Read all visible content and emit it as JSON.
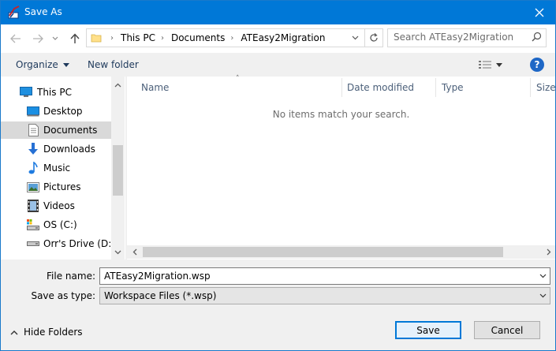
{
  "window": {
    "title": "Save As"
  },
  "address": {
    "breadcrumbs": [
      "This PC",
      "Documents",
      "ATEasy2Migration"
    ]
  },
  "search": {
    "placeholder": "Search ATEasy2Migration"
  },
  "toolbar": {
    "organize": "Organize",
    "new_folder": "New folder",
    "help": "?"
  },
  "nav": {
    "items": [
      {
        "label": "This PC",
        "icon": "pc-icon"
      },
      {
        "label": "Desktop",
        "icon": "desktop-icon"
      },
      {
        "label": "Documents",
        "icon": "documents-icon",
        "selected": true
      },
      {
        "label": "Downloads",
        "icon": "downloads-icon"
      },
      {
        "label": "Music",
        "icon": "music-icon"
      },
      {
        "label": "Pictures",
        "icon": "pictures-icon"
      },
      {
        "label": "Videos",
        "icon": "videos-icon"
      },
      {
        "label": "OS (C:)",
        "icon": "drive-c-icon"
      },
      {
        "label": "Orr's Drive (D:)",
        "icon": "drive-d-icon"
      }
    ]
  },
  "columns": {
    "name": "Name",
    "date_modified": "Date modified",
    "type": "Type",
    "size": "Size"
  },
  "empty_message": "No items match your search.",
  "form": {
    "file_name_label": "File name:",
    "file_name_value": "ATEasy2Migration.wsp",
    "save_type_label": "Save as type:",
    "save_type_value": "Workspace Files (*.wsp)"
  },
  "footer": {
    "hide_folders": "Hide Folders",
    "save": "Save",
    "cancel": "Cancel"
  },
  "colors": {
    "titlebar": "#0078d7",
    "selection": "#d9d9d9",
    "accent": "#0078d7"
  }
}
